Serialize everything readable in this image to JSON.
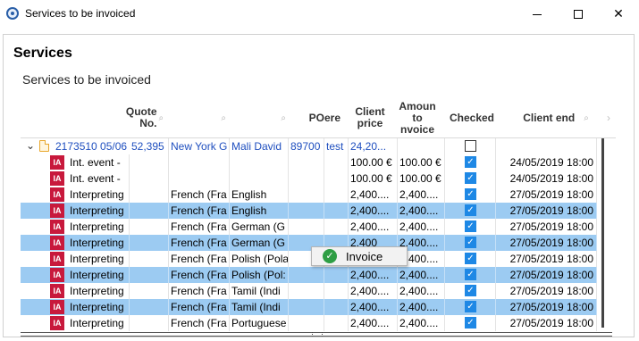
{
  "window": {
    "title": "Services to be invoiced",
    "minimize_icon": "minimize-icon",
    "maximize_icon": "maximize-icon",
    "close_icon": "close-icon"
  },
  "page": {
    "heading": "Services",
    "subtitle": "Services to be invoiced"
  },
  "columns": [
    {
      "label": "Quote No.",
      "line1": "Quote",
      "line2": "No.",
      "filter": true
    },
    {
      "label": "",
      "line1": "",
      "line2": "",
      "filter": true
    },
    {
      "label": "",
      "line1": "",
      "line2": "",
      "filter": true
    },
    {
      "label": "PO",
      "line1": "PO",
      "line2": "",
      "filter": true
    },
    {
      "label": "ere",
      "line1": "ere",
      "line2": "",
      "filter": true
    },
    {
      "label": "Client price",
      "line1": "Client",
      "line2": "price",
      "filter": true
    },
    {
      "label": "Amount to invoice",
      "line1": "Amoun",
      "line2": "to",
      "line3": "nvoice",
      "filter": true
    },
    {
      "label": "Checked",
      "line1": "Checked",
      "line2": "",
      "filter": false
    },
    {
      "label": "Client end",
      "line1": "Client end",
      "line2": "",
      "filter": true
    }
  ],
  "group_row": {
    "expander": "chevron-down-icon",
    "id_date": "2173510 05/06",
    "quote_no": "52,395",
    "client": "New York G",
    "contact": "Mali David",
    "po": "89700",
    "ere": "test",
    "client_price": "24,20...",
    "checked": false
  },
  "rows": [
    {
      "service": "Int. event -",
      "source": "",
      "target": "",
      "client_price": "100.00 €",
      "amount": "100.00 €",
      "checked": true,
      "client_end": "24/05/2019 18:00",
      "selected": false
    },
    {
      "service": "Int. event -",
      "source": "",
      "target": "",
      "client_price": "100.00 €",
      "amount": "100.00 €",
      "checked": true,
      "client_end": "24/05/2019 18:00",
      "selected": false
    },
    {
      "service": "Interpreting",
      "source": "French (Fra",
      "target": "English",
      "client_price": "2,400....",
      "amount": "2,400....",
      "checked": true,
      "client_end": "27/05/2019 18:00",
      "selected": false
    },
    {
      "service": "Interpreting",
      "source": "French (Fra",
      "target": "English",
      "client_price": "2,400....",
      "amount": "2,400....",
      "checked": true,
      "client_end": "27/05/2019 18:00",
      "selected": true
    },
    {
      "service": "Interpreting",
      "source": "French (Fra",
      "target": "German (G",
      "client_price": "2,400....",
      "amount": "2,400....",
      "checked": true,
      "client_end": "27/05/2019 18:00",
      "selected": false
    },
    {
      "service": "Interpreting",
      "source": "French (Fra",
      "target": "German (G",
      "client_price": "2,400",
      "amount": "2,400....",
      "checked": true,
      "client_end": "27/05/2019 18:00",
      "selected": true
    },
    {
      "service": "Interpreting",
      "source": "French (Fra",
      "target": "Polish (Pola",
      "client_price": "2,400....",
      "amount": "2,400....",
      "checked": true,
      "client_end": "27/05/2019 18:00",
      "selected": false
    },
    {
      "service": "Interpreting",
      "source": "French (Fra",
      "target": "Polish (Pol:",
      "client_price": "2,400....",
      "amount": "2,400....",
      "checked": true,
      "client_end": "27/05/2019 18:00",
      "selected": true
    },
    {
      "service": "Interpreting",
      "source": "French (Fra",
      "target": "Tamil (Indi",
      "client_price": "2,400....",
      "amount": "2,400....",
      "checked": true,
      "client_end": "27/05/2019 18:00",
      "selected": false
    },
    {
      "service": "Interpreting",
      "source": "French (Fra",
      "target": "Tamil (Indi",
      "client_price": "2,400....",
      "amount": "2,400....",
      "checked": true,
      "client_end": "27/05/2019 18:00",
      "selected": true
    },
    {
      "service": "Interpreting",
      "source": "French (Fra",
      "target": "Portuguese",
      "client_price": "2,400....",
      "amount": "2,400....",
      "checked": true,
      "client_end": "27/05/2019 18:00",
      "selected": false
    }
  ],
  "popup": {
    "label": "Invoice",
    "icon": "check-circle-icon"
  },
  "colors": {
    "selected_row": "#9ccbf2",
    "link_blue": "#1f4fbf",
    "service_icon": "#c8193c",
    "checkbox_on": "#1e88e5",
    "ok_green": "#2e9e44"
  }
}
